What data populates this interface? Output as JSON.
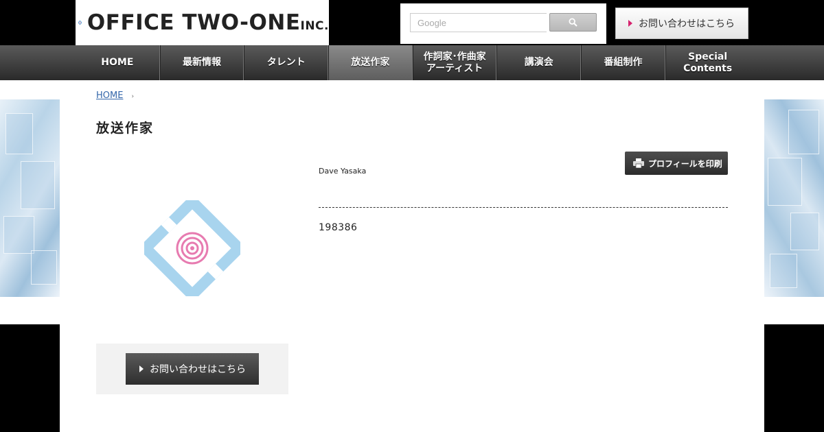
{
  "header": {
    "logo_text": "OFFICE TWO-ONE",
    "logo_suffix": "INC.",
    "search_placeholder": "Google",
    "contact_label": "お問い合わせはこちら"
  },
  "nav": {
    "items": [
      {
        "label": "HOME"
      },
      {
        "label": "最新情報"
      },
      {
        "label": "タレント"
      },
      {
        "label": "放送作家"
      },
      {
        "label": "作詞家･作曲家\nアーティスト"
      },
      {
        "label": "講演会"
      },
      {
        "label": "番組制作"
      },
      {
        "label": "Special\nContents"
      }
    ],
    "active_index": 3
  },
  "breadcrumb": {
    "home": "HOME",
    "separator": "›"
  },
  "main": {
    "page_title": "放送作家",
    "print_label": "プロフィールを印刷",
    "person_name": "Dave Yasaka",
    "person_id": "198386"
  },
  "sidebar": {
    "contact_label": "お問い合わせはこちら"
  },
  "colors": {
    "accent_pink": "#d6226e",
    "logo_blue": "#2a86c5",
    "portrait_blue": "#a8d4ee",
    "portrait_pink": "#e77bb0"
  }
}
